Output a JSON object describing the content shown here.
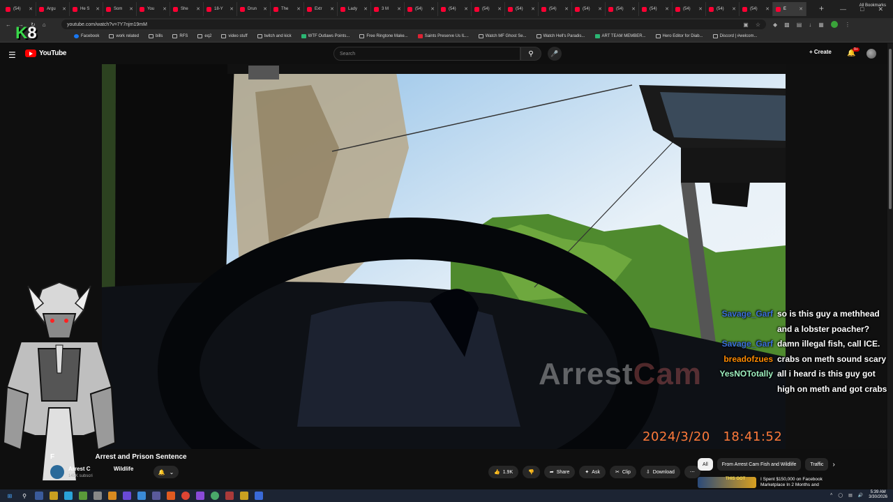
{
  "browser": {
    "tabs": [
      {
        "label": "(54)"
      },
      {
        "label": "Argu"
      },
      {
        "label": "He S"
      },
      {
        "label": "Som"
      },
      {
        "label": "You"
      },
      {
        "label": "She"
      },
      {
        "label": "18-Y"
      },
      {
        "label": "Drun"
      },
      {
        "label": "The"
      },
      {
        "label": "Extr"
      },
      {
        "label": "Lady"
      },
      {
        "label": "3 M"
      },
      {
        "label": "(54)"
      },
      {
        "label": "(54)"
      },
      {
        "label": "(54)"
      },
      {
        "label": "(54)"
      },
      {
        "label": "(54)"
      },
      {
        "label": "(54)"
      },
      {
        "label": "(54)"
      },
      {
        "label": "(54)"
      },
      {
        "label": "(54)"
      },
      {
        "label": "(54)"
      },
      {
        "label": "(54)"
      },
      {
        "label": "E"
      }
    ],
    "url": "youtube.com/watch?v=7Y7njm19mM",
    "bookmarks": [
      {
        "label": "Facebook",
        "icon": "facebook-icon"
      },
      {
        "label": "work related",
        "icon": "folder-icon"
      },
      {
        "label": "bills",
        "icon": "folder-icon"
      },
      {
        "label": "RFS",
        "icon": "folder-icon"
      },
      {
        "label": "eq2",
        "icon": "folder-icon"
      },
      {
        "label": "video stuff",
        "icon": "folder-icon"
      },
      {
        "label": "twitch and kick",
        "icon": "folder-icon"
      },
      {
        "label": "WTF Outlaws Points...",
        "icon": "green-icon"
      },
      {
        "label": "Free Ringtone Make...",
        "icon": "page-icon"
      },
      {
        "label": "Saints Preserve Us IL...",
        "icon": "saints-icon"
      },
      {
        "label": "Watch MF Ghost Se...",
        "icon": "page-icon"
      },
      {
        "label": "Watch Hell's Paradis...",
        "icon": "page-icon"
      },
      {
        "label": "ART TEAM MEMBER...",
        "icon": "green-icon"
      },
      {
        "label": "Hero Editor for Diab...",
        "icon": "page-icon"
      },
      {
        "label": "Discord | #welcom...",
        "icon": "discord-icon"
      }
    ],
    "all_bookmarks": "All Bookmarks"
  },
  "youtube": {
    "logo": "YouTube",
    "search_placeholder": "Search",
    "create": "Create",
    "notifications_badge": "9+"
  },
  "video": {
    "watermark_main": "Arrest",
    "watermark_tail": "Cam",
    "timestamp_date": "2024/3/20",
    "timestamp_time": "18:41:52",
    "title_left": "F",
    "title_right": "Arrest and Prison Sentence",
    "channel_left": "Arrest C",
    "channel_right": "Wildlife",
    "subscribers": "145K subscri",
    "likes": "1.9K",
    "share": "Share",
    "ask": "Ask",
    "clip": "Clip",
    "download": "Download"
  },
  "chips": [
    "All",
    "From Arrest Cam Fish and Wildlife",
    "Traffic"
  ],
  "recommendation": {
    "thumb_text": "THIS GOT",
    "title": "I Spent $150,000 on Facebook Marketplace In 2 Months and"
  },
  "chat": [
    {
      "user": "Savage_Garf",
      "color": "#3b6fd8",
      "text": "so is this guy a methhead and a lobster poacher?"
    },
    {
      "user": "Savage_Garf",
      "color": "#3b6fd8",
      "text": "damn illegal fish, call ICE."
    },
    {
      "user": "breadofzues",
      "color": "#ff8a00",
      "text": "crabs on meth sound scary"
    },
    {
      "user": "YesNOTotally",
      "color": "#9ef0c0",
      "text": "all i heard is this guy got high on meth and got crabs"
    }
  ],
  "overlay": {
    "k": "K",
    "num": "8"
  },
  "clock": {
    "time": "5:39 AM",
    "date": "3/30/2026"
  },
  "colors": {
    "youtube_red": "#ff0000",
    "timestamp": "#ff7a3a",
    "k8_green": "#39d84a"
  }
}
